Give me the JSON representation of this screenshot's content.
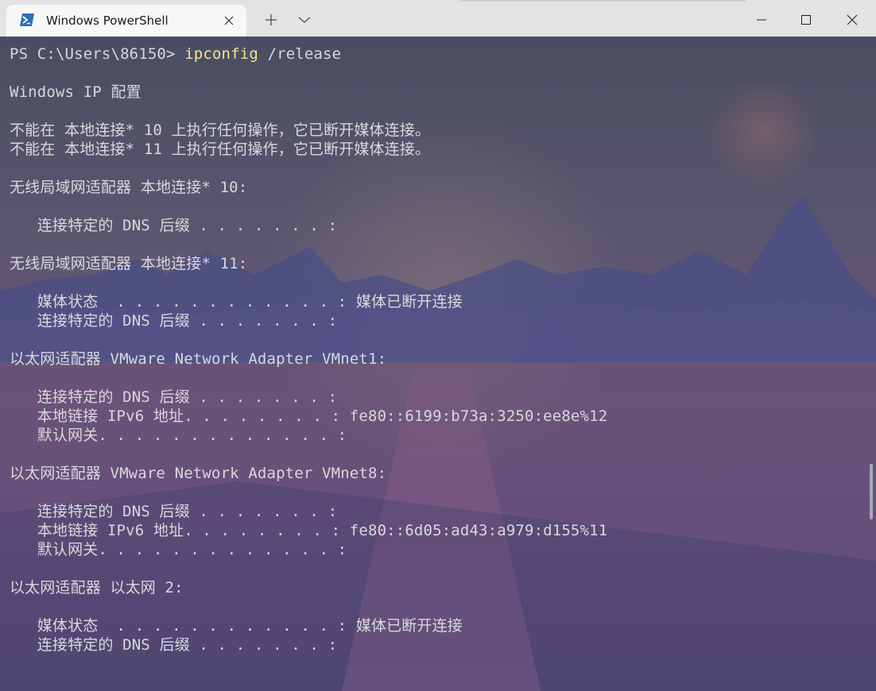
{
  "window": {
    "tab_title": "Windows PowerShell",
    "icons": {
      "tab": "powershell-icon",
      "tab_close": "close-icon",
      "new_tab": "plus-icon",
      "dropdown": "chevron-down-icon",
      "minimize": "minimize-icon",
      "maximize": "maximize-icon",
      "close": "close-icon"
    }
  },
  "terminal": {
    "prompt": "PS C:\\Users\\86150> ",
    "command": "ipconfig",
    "args": " /release",
    "lines": [
      "",
      "Windows IP 配置",
      "",
      "不能在 本地连接* 10 上执行任何操作，它已断开媒体连接。",
      "不能在 本地连接* 11 上执行任何操作，它已断开媒体连接。",
      "",
      "无线局域网适配器 本地连接* 10:",
      "",
      "   连接特定的 DNS 后缀 . . . . . . . :",
      "",
      "无线局域网适配器 本地连接* 11:",
      "",
      "   媒体状态  . . . . . . . . . . . . : 媒体已断开连接",
      "   连接特定的 DNS 后缀 . . . . . . . :",
      "",
      "以太网适配器 VMware Network Adapter VMnet1:",
      "",
      "   连接特定的 DNS 后缀 . . . . . . . :",
      "   本地链接 IPv6 地址. . . . . . . . : fe80::6199:b73a:3250:ee8e%12",
      "   默认网关. . . . . . . . . . . . . :",
      "",
      "以太网适配器 VMware Network Adapter VMnet8:",
      "",
      "   连接特定的 DNS 后缀 . . . . . . . :",
      "   本地链接 IPv6 地址. . . . . . . . : fe80::6d05:ad43:a979:d155%11",
      "   默认网关. . . . . . . . . . . . . :",
      "",
      "以太网适配器 以太网 2:",
      "",
      "   媒体状态  . . . . . . . . . . . . : 媒体已断开连接",
      "   连接特定的 DNS 后缀 . . . . . . . :"
    ]
  },
  "colors": {
    "text": "#d8d8de",
    "command": "#f3e58c",
    "titlebar": "#e3e3e3",
    "tab": "#f7f7f7"
  }
}
